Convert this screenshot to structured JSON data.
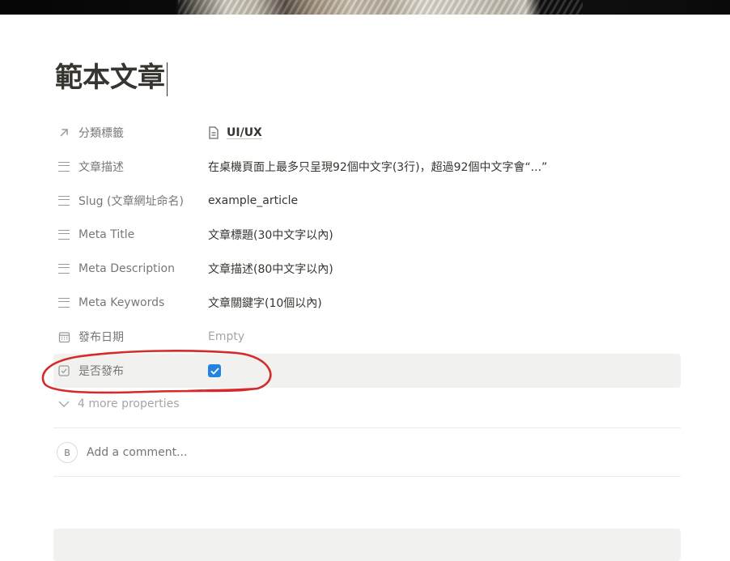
{
  "page": {
    "title": "範本文章"
  },
  "properties": [
    {
      "name": "分類標籤",
      "icon": "arrow-up-right-icon",
      "value": "UI/UX",
      "value_icon": "document-icon"
    },
    {
      "name": "文章描述",
      "icon": "text-lines-icon",
      "value": "在桌機頁面上最多只呈現92個中文字(3行)，超過92個中文字會“...”"
    },
    {
      "name": "Slug (文章網址命名)",
      "icon": "text-lines-icon",
      "value": "example_article"
    },
    {
      "name": "Meta Title",
      "icon": "text-lines-icon",
      "value": "文章標題(30中文字以內)"
    },
    {
      "name": "Meta Description",
      "icon": "text-lines-icon",
      "value": "文章描述(80中文字以內)"
    },
    {
      "name": "Meta Keywords",
      "icon": "text-lines-icon",
      "value": "文章關鍵字(10個以內)"
    },
    {
      "name": "發布日期",
      "icon": "calendar-icon",
      "value": "Empty"
    },
    {
      "name": "是否發布",
      "icon": "checkbox-icon",
      "checked": true
    }
  ],
  "more_properties": "4 more properties",
  "comment": {
    "avatar_initial": "B",
    "placeholder": "Add a comment..."
  },
  "colors": {
    "accent": "#2383e2",
    "annotation": "#d42a2a",
    "highlight_row": "#f1f1ef"
  }
}
